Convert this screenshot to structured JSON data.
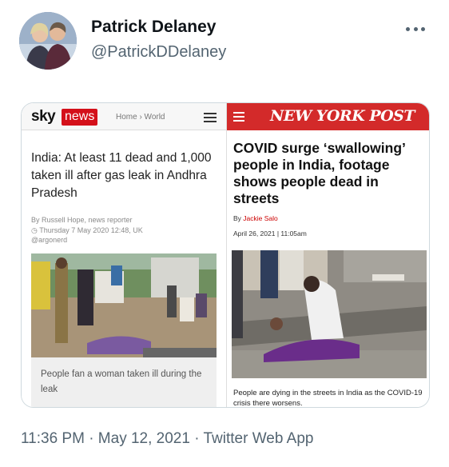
{
  "tweet": {
    "display_name": "Patrick Delaney",
    "handle": "@PatrickDDelaney",
    "timestamp": "11:36 PM · May 12, 2021",
    "separator": " · ",
    "source": "Twitter Web App"
  },
  "sky": {
    "logo_sky": "sky",
    "logo_news": "news",
    "breadcrumb": "Home › World",
    "headline": "India: At least 11 dead and 1,000 taken ill after gas leak in Andhra Pradesh",
    "byline_author": "By Russell Hope, news reporter",
    "byline_date": "Thursday 7 May 2020 12:48, UK",
    "byline_handle": "@argonerd",
    "caption": "People fan a woman taken ill during the leak"
  },
  "nypost": {
    "logo": "NEW YORK POST",
    "headline": "COVID surge ‘swallowing’ people in India, footage shows people dead in streets",
    "author_prefix": "By",
    "author": "Jackie Salo",
    "date": "April 26, 2021 | 11:05am",
    "caption": "People are dying in the streets in India as the COVID-19 crisis there worsens."
  },
  "colors": {
    "sky_red": "#d4101a",
    "nypost_red": "#d32a2a",
    "muted_text": "#536471"
  },
  "icons": {
    "more": "more-dots-icon",
    "menu": "hamburger-menu-icon"
  }
}
